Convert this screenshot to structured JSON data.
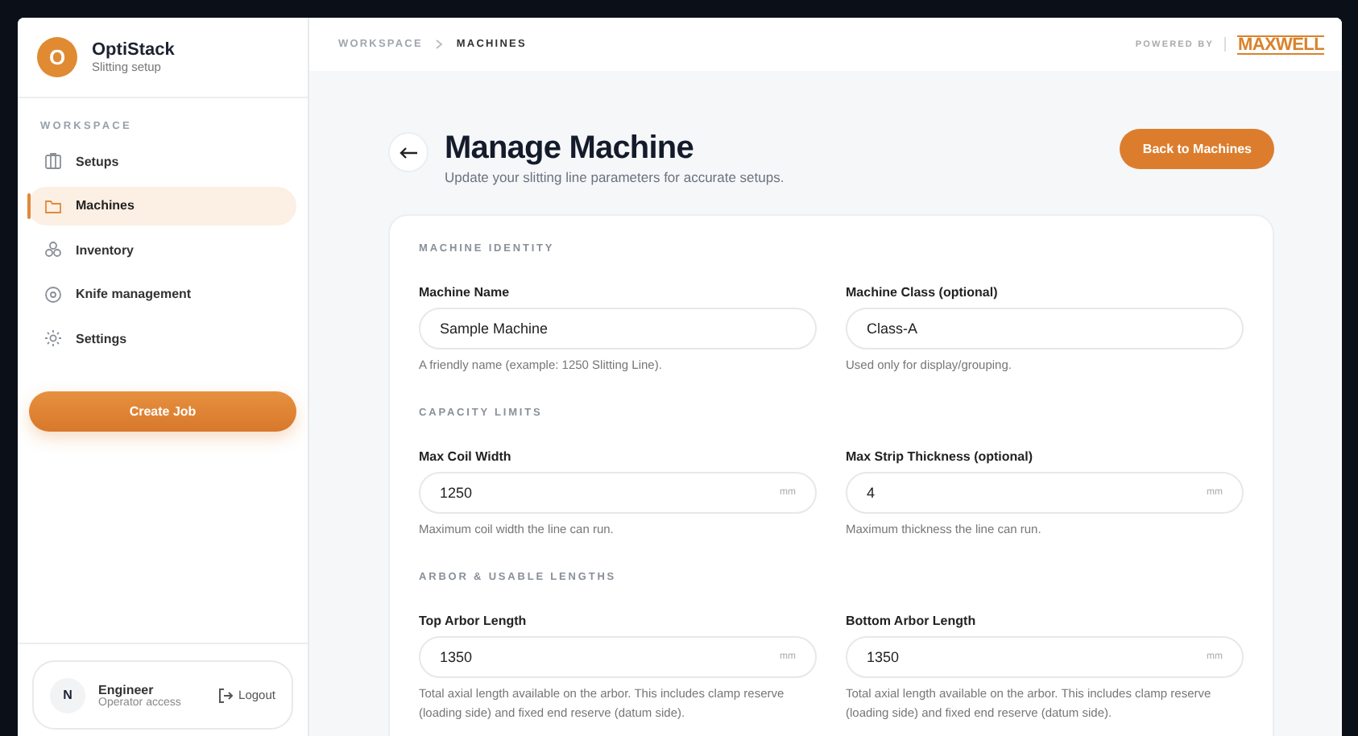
{
  "brand": {
    "initial": "O",
    "name": "OptiStack",
    "subtitle": "Slitting setup"
  },
  "sidebar": {
    "section_label": "WORKSPACE",
    "items": [
      {
        "label": "Setups",
        "selected": false
      },
      {
        "label": "Machines",
        "selected": true
      },
      {
        "label": "Inventory",
        "selected": false
      },
      {
        "label": "Knife management",
        "selected": false
      },
      {
        "label": "Settings",
        "selected": false
      }
    ],
    "create_button": "Create Job",
    "user": {
      "initial": "N",
      "name": "Engineer",
      "role": "Operator access",
      "logout": "Logout"
    }
  },
  "breadcrumb": [
    "WORKSPACE",
    "MACHINES"
  ],
  "powered_by": {
    "label": "POWERED BY",
    "logo": "MAXWELL"
  },
  "page": {
    "title": "Manage Machine",
    "subtitle": "Update your slitting line parameters for accurate setups.",
    "action": "Back to Machines"
  },
  "sections": [
    {
      "title": "MACHINE IDENTITY",
      "fields": [
        {
          "label": "Machine Name",
          "value": "Sample Machine",
          "help": "A friendly name (example: 1250 Slitting Line)."
        },
        {
          "label": "Machine Class (optional)",
          "value": "Class-A",
          "help": "Used only for display/grouping."
        }
      ]
    },
    {
      "title": "CAPACITY LIMITS",
      "fields": [
        {
          "label": "Max Coil Width",
          "value": "1250",
          "unit": "mm",
          "help": "Maximum coil width the line can run."
        },
        {
          "label": "Max Strip Thickness (optional)",
          "value": "4",
          "unit": "mm",
          "help": "Maximum thickness the line can run."
        }
      ]
    },
    {
      "title": "ARBOR & USABLE LENGTHS",
      "fields": [
        {
          "label": "Top Arbor Length",
          "value": "1350",
          "unit": "mm",
          "help": "Total axial length available on the arbor. This includes clamp reserve (loading side) and fixed end reserve (datum side)."
        },
        {
          "label": "Bottom Arbor Length",
          "value": "1350",
          "unit": "mm",
          "help": "Total axial length available on the arbor. This includes clamp reserve (loading side) and fixed end reserve (datum side)."
        }
      ]
    }
  ]
}
